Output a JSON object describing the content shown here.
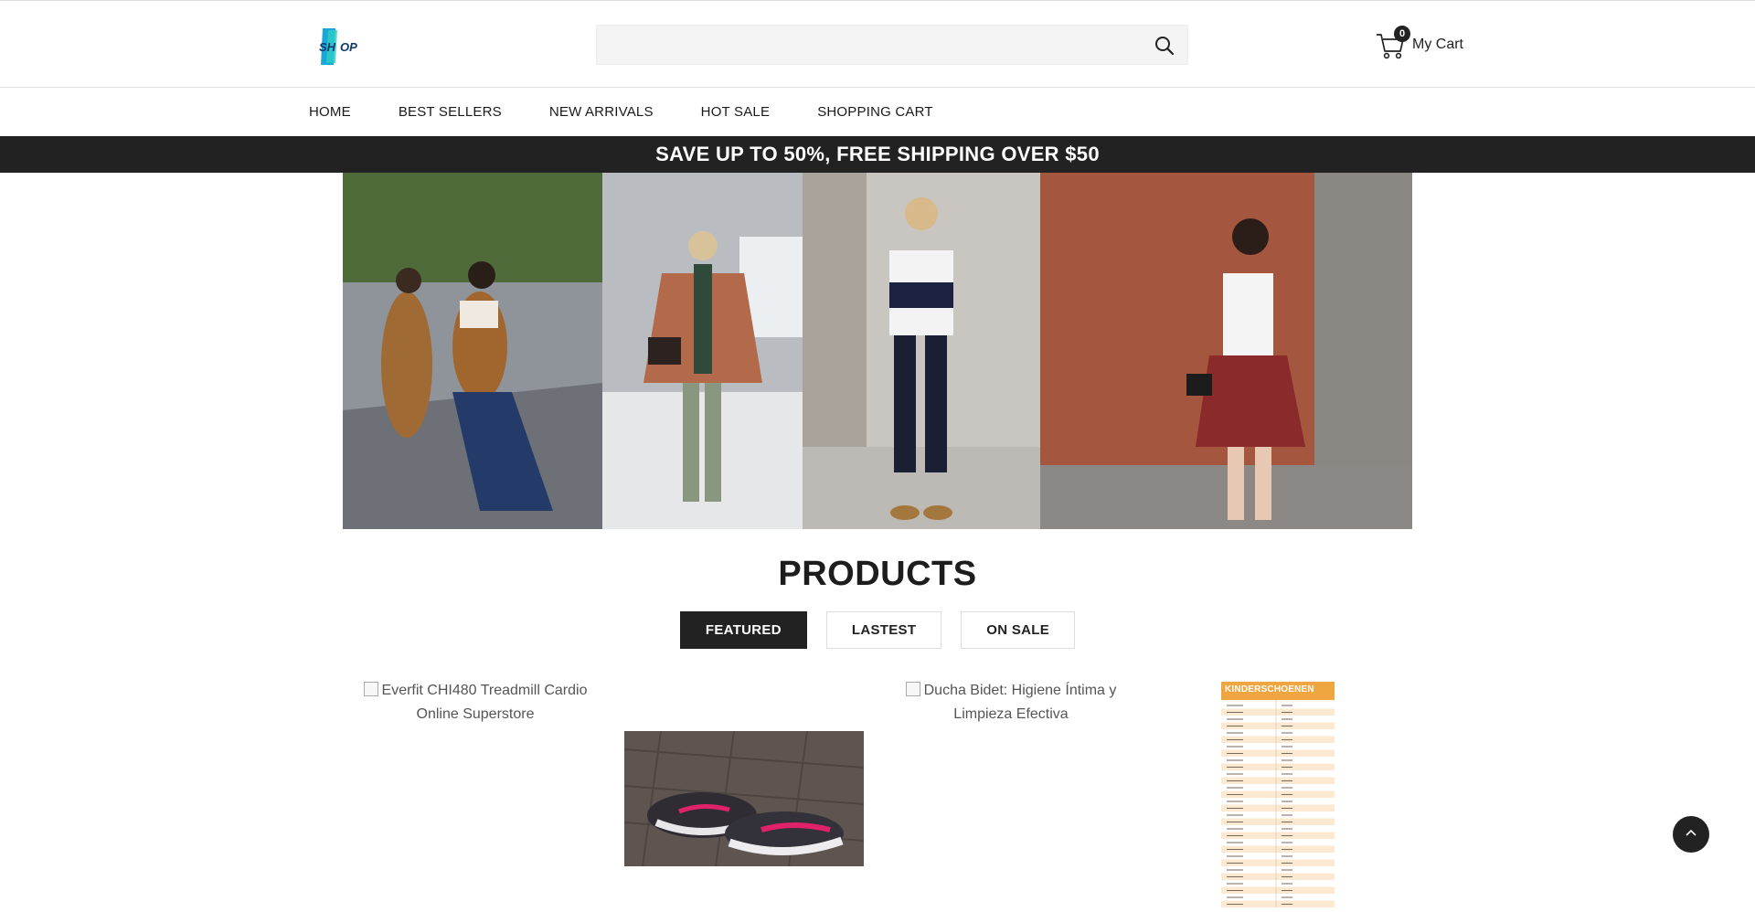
{
  "header": {
    "logo_text": "SHOP",
    "search": {
      "placeholder": "",
      "value": ""
    },
    "cart": {
      "count": "0",
      "label": "My Cart"
    }
  },
  "nav": {
    "items": [
      {
        "label": "HOME"
      },
      {
        "label": "BEST SELLERS"
      },
      {
        "label": "NEW ARRIVALS"
      },
      {
        "label": "HOT SALE"
      },
      {
        "label": "SHOPPING CART"
      }
    ]
  },
  "promo": {
    "text": "SAVE UP TO 50%, FREE SHIPPING OVER $50"
  },
  "products": {
    "title": "PRODUCTS",
    "tabs": [
      {
        "label": "FEATURED",
        "active": true
      },
      {
        "label": "LASTEST",
        "active": false
      },
      {
        "label": "ON SALE",
        "active": false
      }
    ],
    "items": [
      {
        "alt_line1": "Everfit CHI480 Treadmill Cardio",
        "alt_line2": "Online Superstore"
      },
      {
        "alt_line1": "Ducha Bidet: Higiene Íntima y",
        "alt_line2": "Limpieza Efectiva"
      }
    ],
    "size_chart_title": "KINDERSCHOENEN"
  },
  "colors": {
    "accent_dark": "#222222",
    "logo_blue": "#1aa7d8",
    "chart_orange": "#f0a640"
  },
  "icons": {
    "search": "search-icon",
    "cart": "cart-icon",
    "back_to_top": "chevron-up-icon"
  }
}
